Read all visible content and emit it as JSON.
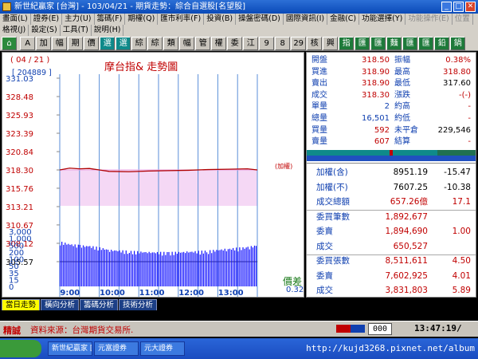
{
  "window": {
    "title": "新世紀贏家 [台灣] - 103/04/21 - 期貨走勢：綜合自選股[名望股]"
  },
  "menu_row1": [
    "畫面(L)",
    "證券(E)",
    "主力(U)",
    "籌碼(F)",
    "期權(Q)",
    "匯市利率(F)",
    "投資(B)",
    "操盤密碼(D)",
    "國際資訊(I)",
    "金融(C)",
    "功能選擇(Y)",
    "功能操作(E)",
    "位置"
  ],
  "menu_row2": [
    "格視(J)",
    "設定(S)",
    "工具(T)",
    "說明(H)"
  ],
  "toolbar": [
    "A",
    "加",
    "幅",
    "期",
    "價",
    "選",
    "選",
    "綜",
    "綜",
    "類",
    "幅",
    "管",
    "權",
    "委",
    "江",
    "9",
    "8",
    "29",
    "核",
    "興",
    "指",
    "匯",
    "匯",
    "麵",
    "匯",
    "匯",
    "鉛",
    "鍋"
  ],
  "chart": {
    "date": "( 04 / 21 )",
    "volume_tag": "[ 204889 ]",
    "title": "摩台指&  走勢圖",
    "ref_tag": "(加權)",
    "price_ticks": [
      "331.03",
      "328.48",
      "325.93",
      "323.39",
      "320.84",
      "318.30",
      "315.76",
      "313.21",
      "310.67",
      "308.12",
      "305.57"
    ],
    "volume_ticks": [
      "3,000",
      "1,000",
      "500",
      "200",
      "100",
      "50",
      "35",
      "15",
      "0"
    ],
    "time_ticks": [
      "9:00",
      "10:00",
      "11:00",
      "12:00",
      "13:00"
    ],
    "spread_label": "價差",
    "spread_value": "0.32",
    "colors": {
      "up_fill": "#f5d8f5",
      "price_line": "#b00000",
      "volume": "#1010ff",
      "grid": "#5a8ed8"
    }
  },
  "chart_data": {
    "type": "line",
    "x": [
      "8:45",
      "9:00",
      "9:15",
      "9:30",
      "10:00",
      "10:30",
      "11:00",
      "11:30",
      "12:00",
      "12:30",
      "13:00",
      "13:30",
      "13:45"
    ],
    "series": [
      {
        "values": [
          318.3,
          318.55,
          318.45,
          318.5,
          318.1,
          318.05,
          318.15,
          318.2,
          318.25,
          318.35,
          318.4,
          318.45,
          318.3
        ]
      }
    ],
    "volume": [
      700,
      500,
      420,
      380,
      220,
      180,
      160,
      150,
      170,
      190,
      260,
      320,
      450
    ],
    "ylim": [
      305.57,
      331.03
    ],
    "reference": 318.3
  },
  "quote": {
    "rows": [
      {
        "l1": "開盤",
        "v1": "318.50",
        "l2": "振幅",
        "v2": "0.38%"
      },
      {
        "l1": "買進",
        "v1": "318.90",
        "l2": "最高",
        "v2": "318.80"
      },
      {
        "l1": "賣出",
        "v1": "318.90",
        "l2": "最低",
        "v2": "317.60"
      },
      {
        "l1": "成交",
        "v1": "318.30",
        "l2": "漲跌",
        "v2": "-(-)"
      },
      {
        "l1": "單量",
        "v1": "2",
        "l2": "約高",
        "v2": "-"
      },
      {
        "l1": "總量",
        "v1": "16,501",
        "l2": "約低",
        "v2": "-"
      },
      {
        "l1": "買量",
        "v1": "592",
        "l2": "未平倉",
        "v2": "229,546"
      },
      {
        "l1": "賣量",
        "v1": "607",
        "l2": "結算",
        "v2": "-"
      }
    ]
  },
  "stats": {
    "rows": [
      {
        "label": "加權(含)",
        "v1": "8951.19",
        "v2": "-15.47"
      },
      {
        "label": "加權(不)",
        "v1": "7607.25",
        "v2": "-10.38"
      },
      {
        "label": "成交總額",
        "v1": "657.26億",
        "v2": "17.1"
      },
      {
        "label": "委買筆數",
        "v1": "1,892,677",
        "v2": ""
      },
      {
        "label": "委賣",
        "v1": "1,894,690",
        "v2": "1.00"
      },
      {
        "label": "成交",
        "v1": "650,527",
        "v2": ""
      },
      {
        "label": "委買張數",
        "v1": "8,511,611",
        "v2": "4.50"
      },
      {
        "label": "委賣",
        "v1": "7,602,925",
        "v2": "4.01"
      },
      {
        "label": "成交",
        "v1": "3,831,803",
        "v2": "5.89"
      }
    ]
  },
  "bottom_tabs": [
    "當日走勢",
    "橫向分析",
    "籌碼分析",
    "技術分析"
  ],
  "status": {
    "mode": "精誠",
    "source": "資料來源：台灣期貨交易所.",
    "counter": "000",
    "clock": "13:47:19/"
  },
  "taskbar": {
    "items": [
      "新世紀贏家 [台灣]",
      "元富證券",
      "元大證券"
    ],
    "url": "http://kujd3268.pixnet.net/album"
  }
}
